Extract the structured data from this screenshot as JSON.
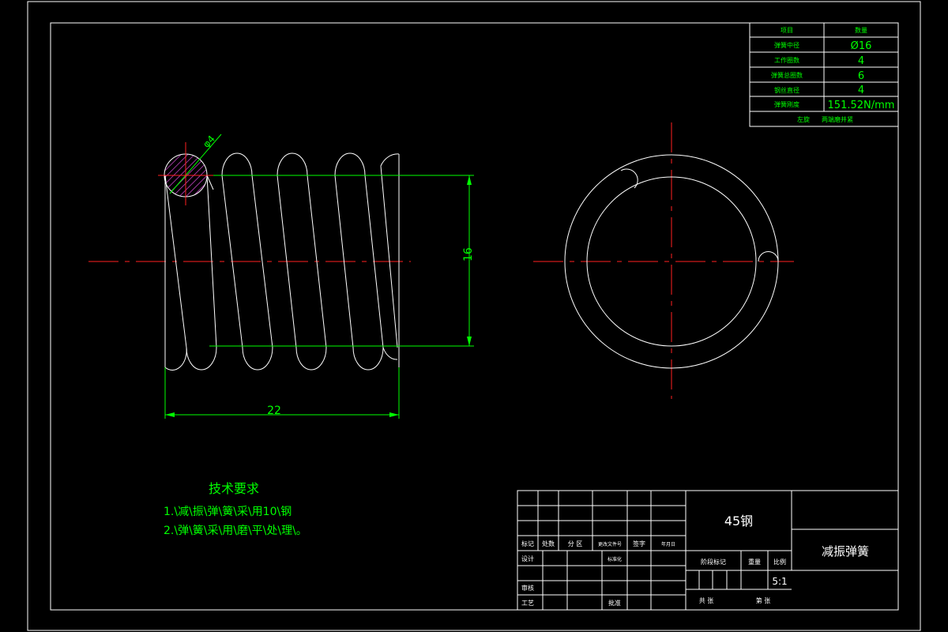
{
  "spring_params": {
    "header_item": "项目",
    "header_value": "数量",
    "rows": [
      {
        "label": "弹簧中径",
        "value": "Ø16"
      },
      {
        "label": "工作圈数",
        "value": "4"
      },
      {
        "label": "弹簧总圈数",
        "value": "6"
      },
      {
        "label": "钢丝直径",
        "value": "4"
      },
      {
        "label": "弹簧刚度",
        "value": "151.52N/mm"
      }
    ],
    "footer_label": "左旋",
    "footer_value": "两端磨并紧"
  },
  "dimensions": {
    "wire_diameter": "φ4",
    "height": "16",
    "length": "22"
  },
  "tech_requirements": {
    "title": "技术要求",
    "line1": "1.\\减\\振\\弹\\簧\\采\\用10\\钢",
    "line2": "2.\\弹\\簧\\采\\用\\磨\\平\\处\\理\\。"
  },
  "title_block": {
    "material": "45钢",
    "part_name": "减振弹簧",
    "scale": "5:1",
    "labels": {
      "mark": "标记",
      "count": "处数",
      "zone": "分 区",
      "doc_no": "更改文件号",
      "signature": "签字",
      "date": "年月日",
      "design": "设计",
      "standardize": "标准化",
      "stage_mark": "阶段标记",
      "weight": "重量",
      "scale_label": "比例",
      "review": "审核",
      "process": "工艺",
      "approve": "批准",
      "total": "共 张",
      "sheet": "第 张"
    }
  }
}
